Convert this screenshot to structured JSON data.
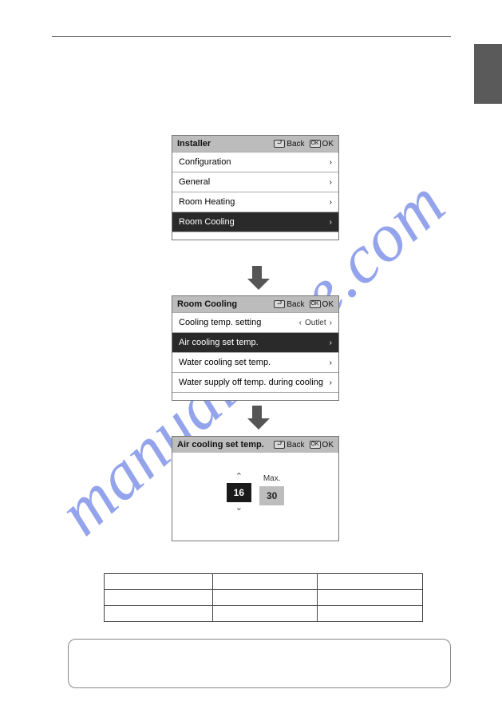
{
  "watermark": "manualshive.com",
  "panel1": {
    "title": "Installer",
    "back_label": "Back",
    "ok_label": "OK",
    "back_icon": "⮐",
    "ok_icon": "OK",
    "items": [
      {
        "label": "Configuration",
        "selected": false
      },
      {
        "label": "General",
        "selected": false
      },
      {
        "label": "Room Heating",
        "selected": false
      },
      {
        "label": "Room Cooling",
        "selected": true
      }
    ],
    "cut_label": ""
  },
  "panel2": {
    "title": "Room Cooling",
    "back_label": "Back",
    "ok_label": "OK",
    "back_icon": "⮐",
    "ok_icon": "OK",
    "items": [
      {
        "label": "Cooling temp. setting",
        "option": "Outlet",
        "selected": false
      },
      {
        "label": "Air cooling set temp.",
        "selected": true
      },
      {
        "label": "Water cooling set temp.",
        "selected": false
      },
      {
        "label": "Water supply off temp. during cooling",
        "selected": false
      }
    ],
    "cut_label": ""
  },
  "panel3": {
    "title": "Air cooling set temp.",
    "back_label": "Back",
    "ok_label": "OK",
    "back_icon": "⮐",
    "ok_icon": "OK",
    "current_value": "16",
    "max_label": "Max.",
    "max_value": "30"
  }
}
